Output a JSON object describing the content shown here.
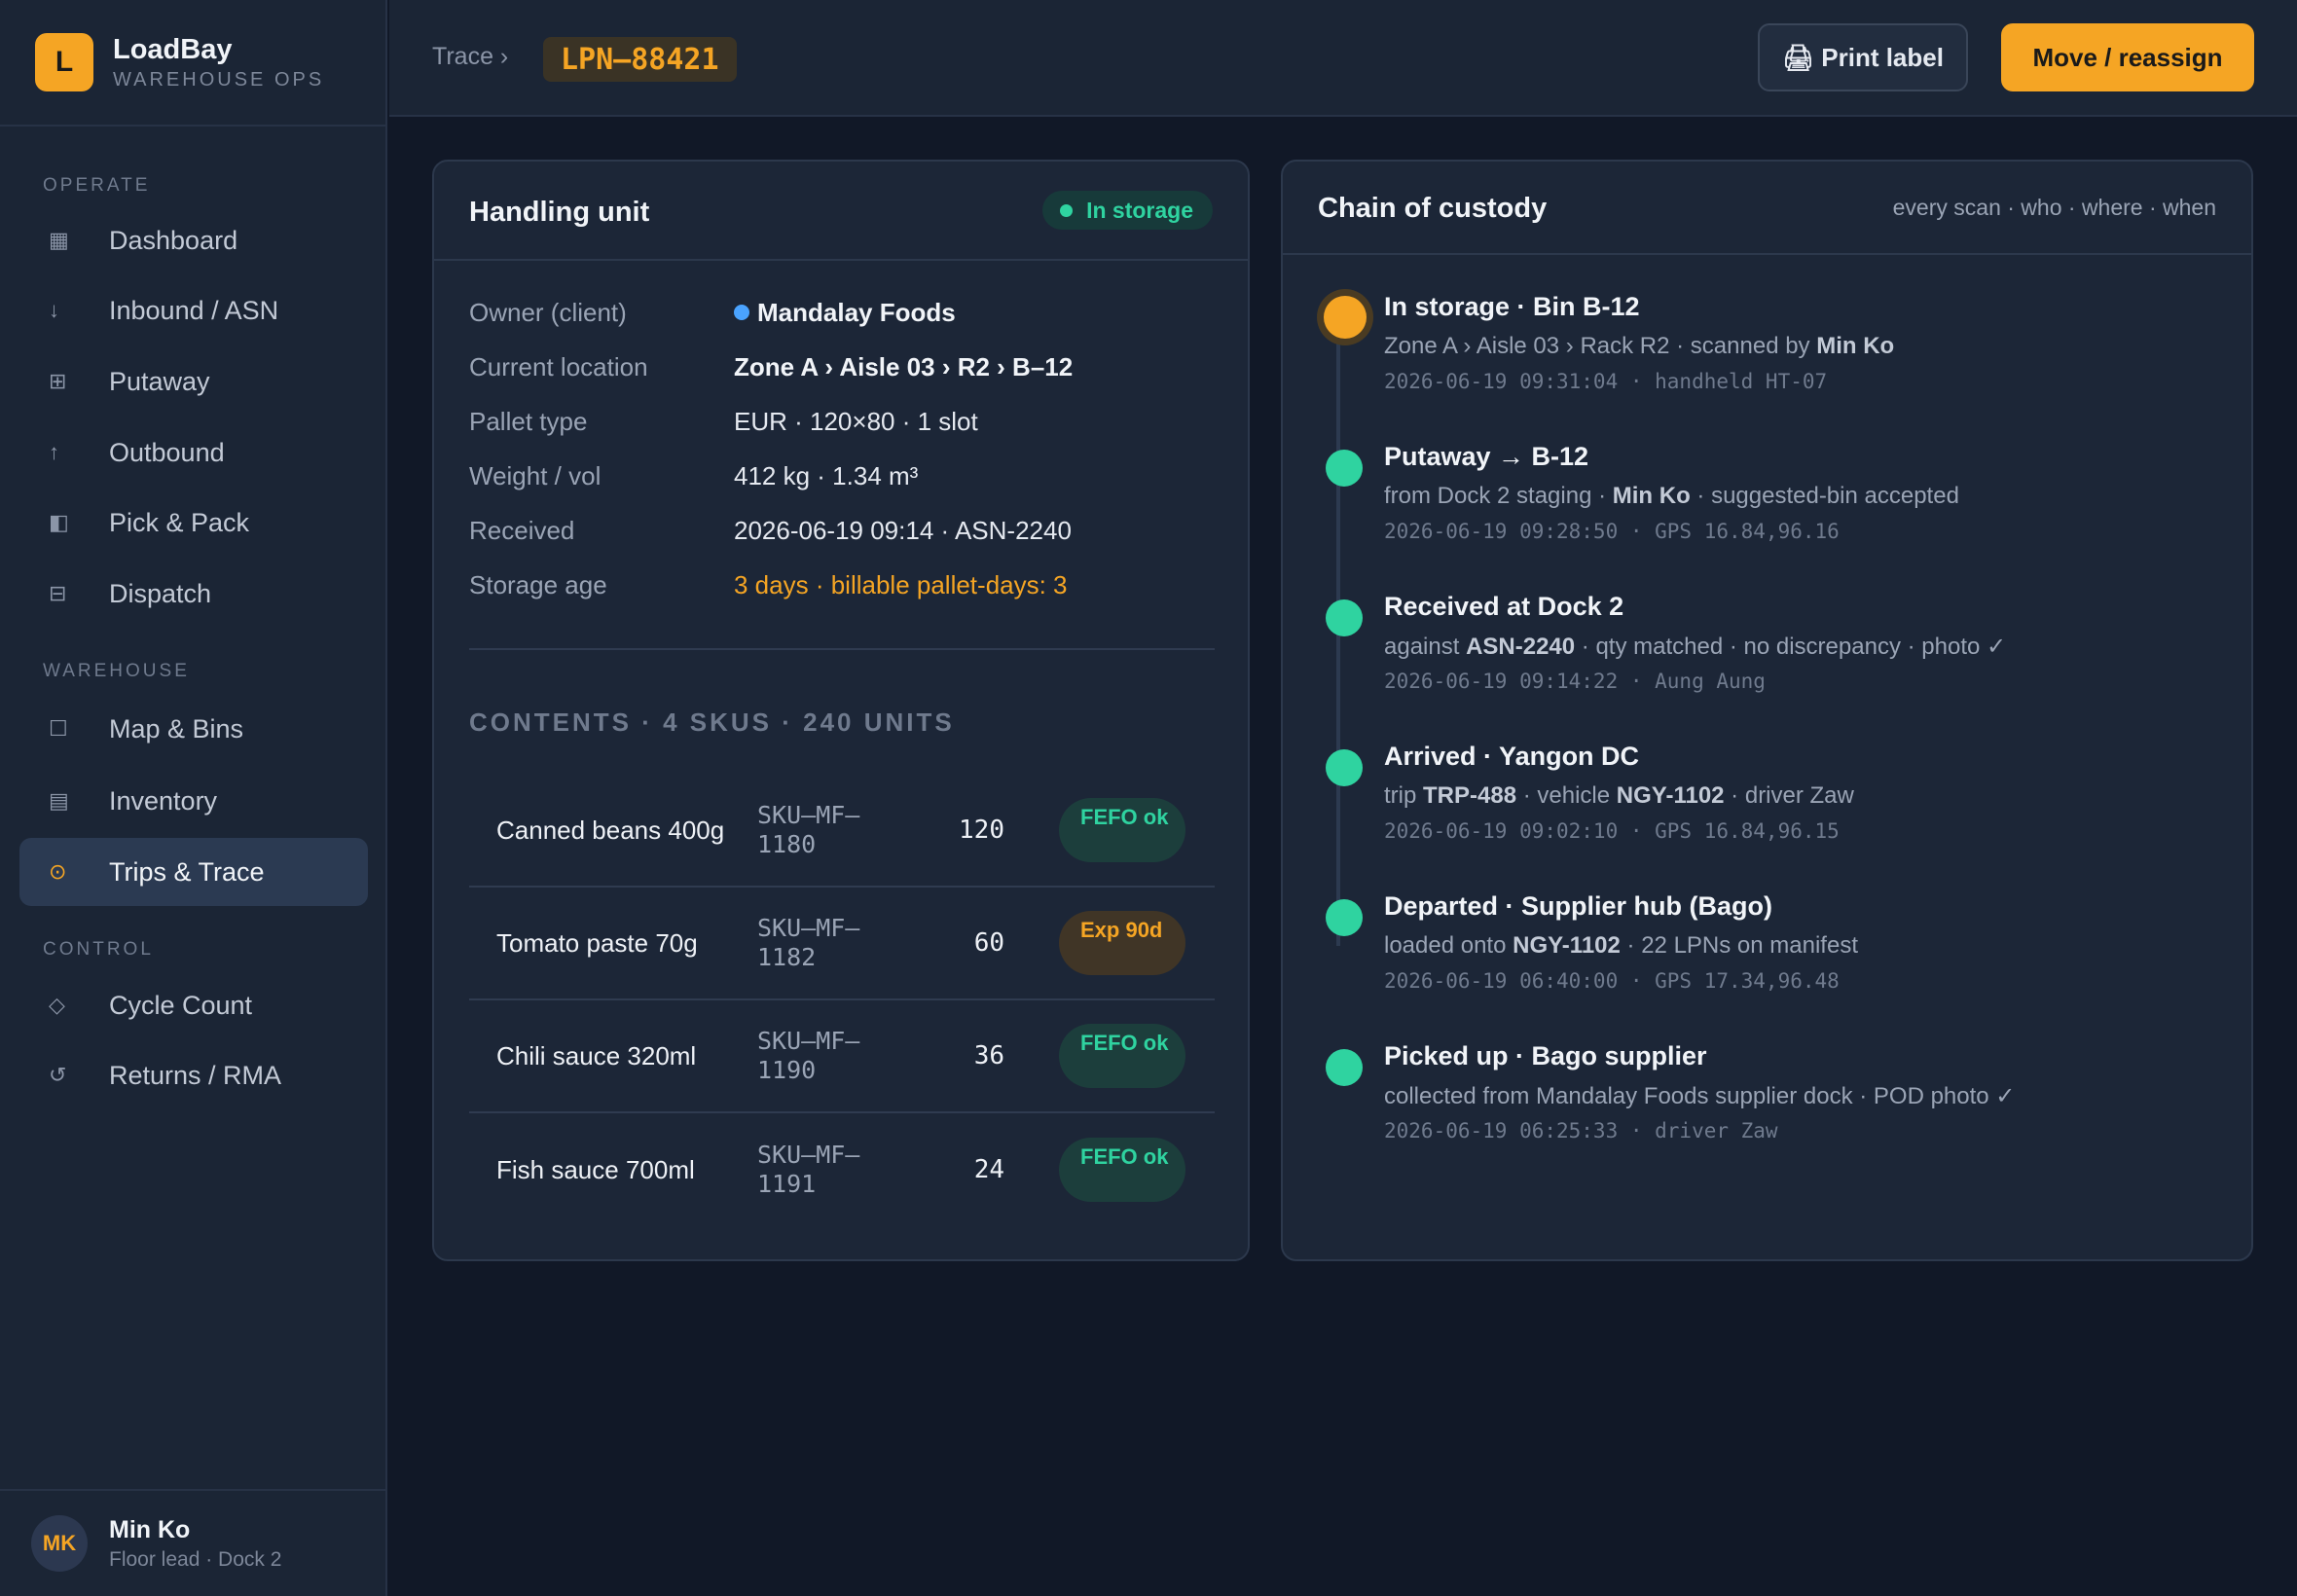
{
  "brand": {
    "logo_letter": "L",
    "name": "LoadBay",
    "subtitle": "WAREHOUSE OPS"
  },
  "nav": {
    "sections": [
      {
        "title": "OPERATE",
        "items": [
          {
            "label": "Dashboard",
            "icon": "grid-square-icon",
            "glyph": "▦"
          },
          {
            "label": "Inbound / ASN",
            "icon": "arrow-down-icon",
            "glyph": "↓"
          },
          {
            "label": "Putaway",
            "icon": "grid-plus-icon",
            "glyph": "⊞"
          },
          {
            "label": "Outbound",
            "icon": "arrow-up-icon",
            "glyph": "↑"
          },
          {
            "label": "Pick & Pack",
            "icon": "half-box-icon",
            "glyph": "◧"
          },
          {
            "label": "Dispatch",
            "icon": "box-minus-icon",
            "glyph": "⊟"
          }
        ]
      },
      {
        "title": "WAREHOUSE",
        "items": [
          {
            "label": "Map & Bins",
            "icon": "square-outline-icon",
            "glyph": "☐"
          },
          {
            "label": "Inventory",
            "icon": "grid-lines-icon",
            "glyph": "▤"
          },
          {
            "label": "Trips & Trace",
            "icon": "target-icon",
            "glyph": "⊙",
            "active": true
          }
        ]
      },
      {
        "title": "CONTROL",
        "items": [
          {
            "label": "Cycle Count",
            "icon": "diamond-icon",
            "glyph": "◇"
          },
          {
            "label": "Returns / RMA",
            "icon": "refresh-icon",
            "glyph": "↺"
          }
        ]
      }
    ]
  },
  "user": {
    "initials": "MK",
    "name": "Min Ko",
    "role": "Floor lead · Dock 2"
  },
  "header": {
    "breadcrumb": "Trace ›",
    "lpn": "LPN–88421",
    "print_label": "🖨 Print label",
    "move_label": "Move / reassign"
  },
  "handling_unit": {
    "title": "Handling unit",
    "status": "In storage",
    "fields": [
      {
        "key": "Owner (client)",
        "value": "Mandalay Foods"
      },
      {
        "key": "Current location",
        "value": "Zone A › Aisle 03 › R2 › B–12"
      },
      {
        "key": "Pallet type",
        "value": "EUR · 120×80 · 1 slot"
      },
      {
        "key": "Weight / vol",
        "value": "412 kg · 1.34 m³"
      },
      {
        "key": "Received",
        "value": "2026-06-19 09:14 · ASN-2240"
      },
      {
        "key": "Storage age",
        "value": "3 days · billable pallet-days: 3"
      }
    ],
    "contents_title": "CONTENTS · 4 SKUS · 240 UNITS",
    "contents": [
      {
        "name": "Canned beans 400g",
        "sku": "SKU–MF–1180",
        "qty": "120",
        "badge": "FEFO ok"
      },
      {
        "name": "Tomato paste 70g",
        "sku": "SKU–MF–1182",
        "qty": "60",
        "badge": "Exp 90d"
      },
      {
        "name": "Chili sauce 320ml",
        "sku": "SKU–MF–1190",
        "qty": "36",
        "badge": "FEFO ok"
      },
      {
        "name": "Fish sauce 700ml",
        "sku": "SKU–MF–1191",
        "qty": "24",
        "badge": "FEFO ok"
      }
    ]
  },
  "custody": {
    "title": "Chain of custody",
    "meta": "every scan · who · where · when",
    "events": [
      {
        "title": "In storage · Bin B-12",
        "desc": [
          "Zone A › Aisle 03 › Rack R2 · scanned by ",
          "Min Ko",
          ""
        ],
        "meta": "2026-06-19 09:31:04 · handheld HT-07"
      },
      {
        "title": "Putaway → B-12",
        "desc": [
          "from Dock 2 staging · ",
          "Min Ko",
          " · suggested-bin accepted"
        ],
        "meta": "2026-06-19 09:28:50 · GPS 16.84,96.16"
      },
      {
        "title": "Received at Dock 2",
        "desc": [
          "against ",
          "ASN-2240",
          " · qty matched · no discrepancy · photo ✓"
        ],
        "meta": "2026-06-19 09:14:22 · Aung Aung"
      },
      {
        "title": "Arrived · Yangon DC",
        "desc": [
          "trip ",
          "TRP-488",
          " · vehicle ",
          "NGY-1102",
          " · driver Zaw"
        ],
        "meta": "2026-06-19 09:02:10 · GPS 16.84,96.15"
      },
      {
        "title": "Departed · Supplier hub (Bago)",
        "desc": [
          "loaded onto ",
          "NGY-1102",
          " · 22 LPNs on manifest"
        ],
        "meta": "2026-06-19 06:40:00 · GPS 17.34,96.48"
      },
      {
        "title": "Picked up · Bago supplier",
        "desc": [
          "collected from Mandalay Foods supplier dock · POD photo ✓"
        ],
        "meta": "2026-06-19 06:25:33 · driver Zaw"
      }
    ]
  }
}
